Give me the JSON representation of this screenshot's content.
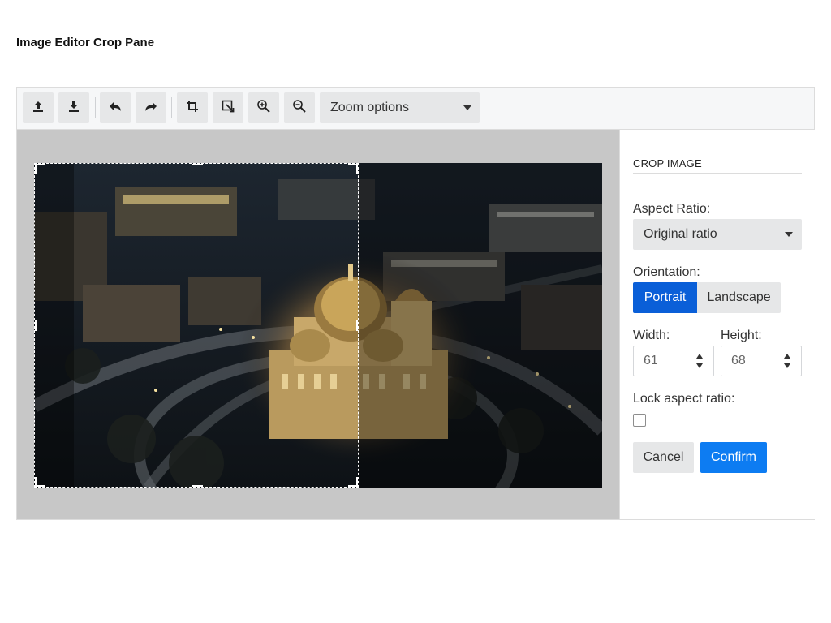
{
  "page": {
    "title": "Image Editor Crop Pane"
  },
  "toolbar": {
    "buttons": [
      {
        "id": "open",
        "icon": "upload-icon"
      },
      {
        "id": "save",
        "icon": "download-icon"
      },
      {
        "id": "undo",
        "icon": "undo-icon"
      },
      {
        "id": "redo",
        "icon": "redo-icon"
      },
      {
        "id": "crop",
        "icon": "crop-icon"
      },
      {
        "id": "transform",
        "icon": "transform-icon"
      },
      {
        "id": "zoom-in",
        "icon": "zoom-in-icon"
      },
      {
        "id": "zoom-out",
        "icon": "zoom-out-icon"
      }
    ],
    "zoom_label": "Zoom options"
  },
  "crop_panel": {
    "heading": "CROP IMAGE",
    "aspect_ratio_label": "Aspect Ratio:",
    "aspect_ratio_value": "Original ratio",
    "orientation_label": "Orientation:",
    "orientation_options": [
      "Portrait",
      "Landscape"
    ],
    "orientation_selected": "Portrait",
    "width_label": "Width:",
    "width_value": "61",
    "height_label": "Height:",
    "height_value": "68",
    "lock_label": "Lock aspect ratio:",
    "lock_checked": false,
    "cancel_label": "Cancel",
    "confirm_label": "Confirm"
  },
  "colors": {
    "accent": "#0d7cf2",
    "selected_segment": "#0a5fd8",
    "canvas_background": "#c7c7c7"
  }
}
